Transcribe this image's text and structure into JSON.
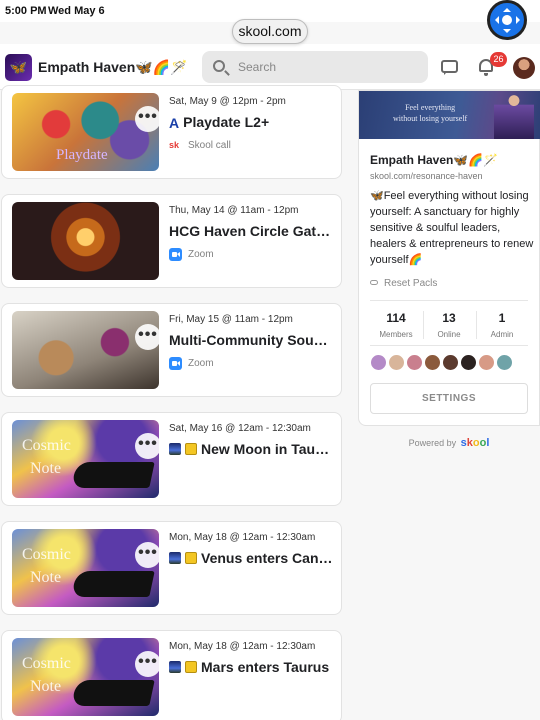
{
  "status_bar": {
    "time": "5:00 PM",
    "date": "Wed May 6"
  },
  "browser": {
    "url": "skool.com"
  },
  "header": {
    "group_name": "Empath Haven🦋🌈🪄",
    "search_placeholder": "Search",
    "notification_count": "26"
  },
  "events": [
    {
      "date": "Sat, May 9 @ 12pm - 2pm",
      "title_icon": "A",
      "title": "Playdate L2+",
      "platform": "Skool call",
      "platform_icon": "sk",
      "thumb": "playdate",
      "thumb_text": "Playdate"
    },
    {
      "date": "Thu, May 14 @ 11am - 12pm",
      "title": "HCG Haven Circle Gathering",
      "platform": "Zoom",
      "thumb": "circle"
    },
    {
      "date": "Fri, May 15 @ 11am - 12pm",
      "title": "Multi-Community Sound Bath",
      "platform": "Zoom",
      "thumb": "sound"
    },
    {
      "date": "Sat, May 16 @ 12am - 12:30am",
      "title": "New Moon in Taurus",
      "thumb": "cosmic",
      "thumb_text_1": "Cosmic",
      "thumb_text_2": "Note"
    },
    {
      "date": "Mon, May 18 @ 12am - 12:30am",
      "title": "Venus enters Cancer",
      "thumb": "cosmic",
      "thumb_text_1": "Cosmic",
      "thumb_text_2": "Note"
    },
    {
      "date": "Mon, May 18 @ 12am - 12:30am",
      "title": "Mars enters Taurus",
      "thumb": "cosmic",
      "thumb_text_1": "Cosmic",
      "thumb_text_2": "Note"
    }
  ],
  "about": {
    "banner_text_1": "Feel everything",
    "banner_text_2": "without losing yourself",
    "name": "Empath Haven🦋🌈🪄",
    "url": "skool.com/resonance-haven",
    "description": "🦋Feel everything without losing yourself: A sanctuary for highly sensitive & soulful leaders, healers & entrepreneurs to renew yourself🌈",
    "reset_link": "Reset Pacls",
    "stats": [
      {
        "value": "114",
        "label": "Members"
      },
      {
        "value": "13",
        "label": "Online"
      },
      {
        "value": "1",
        "label": "Admin"
      }
    ],
    "settings_label": "SETTINGS"
  },
  "footer": {
    "powered_by": "Powered by",
    "brand": "skool"
  },
  "colors": {
    "accent": "#1a73e8",
    "badge": "#e53935",
    "zoom": "#2d8cff"
  }
}
